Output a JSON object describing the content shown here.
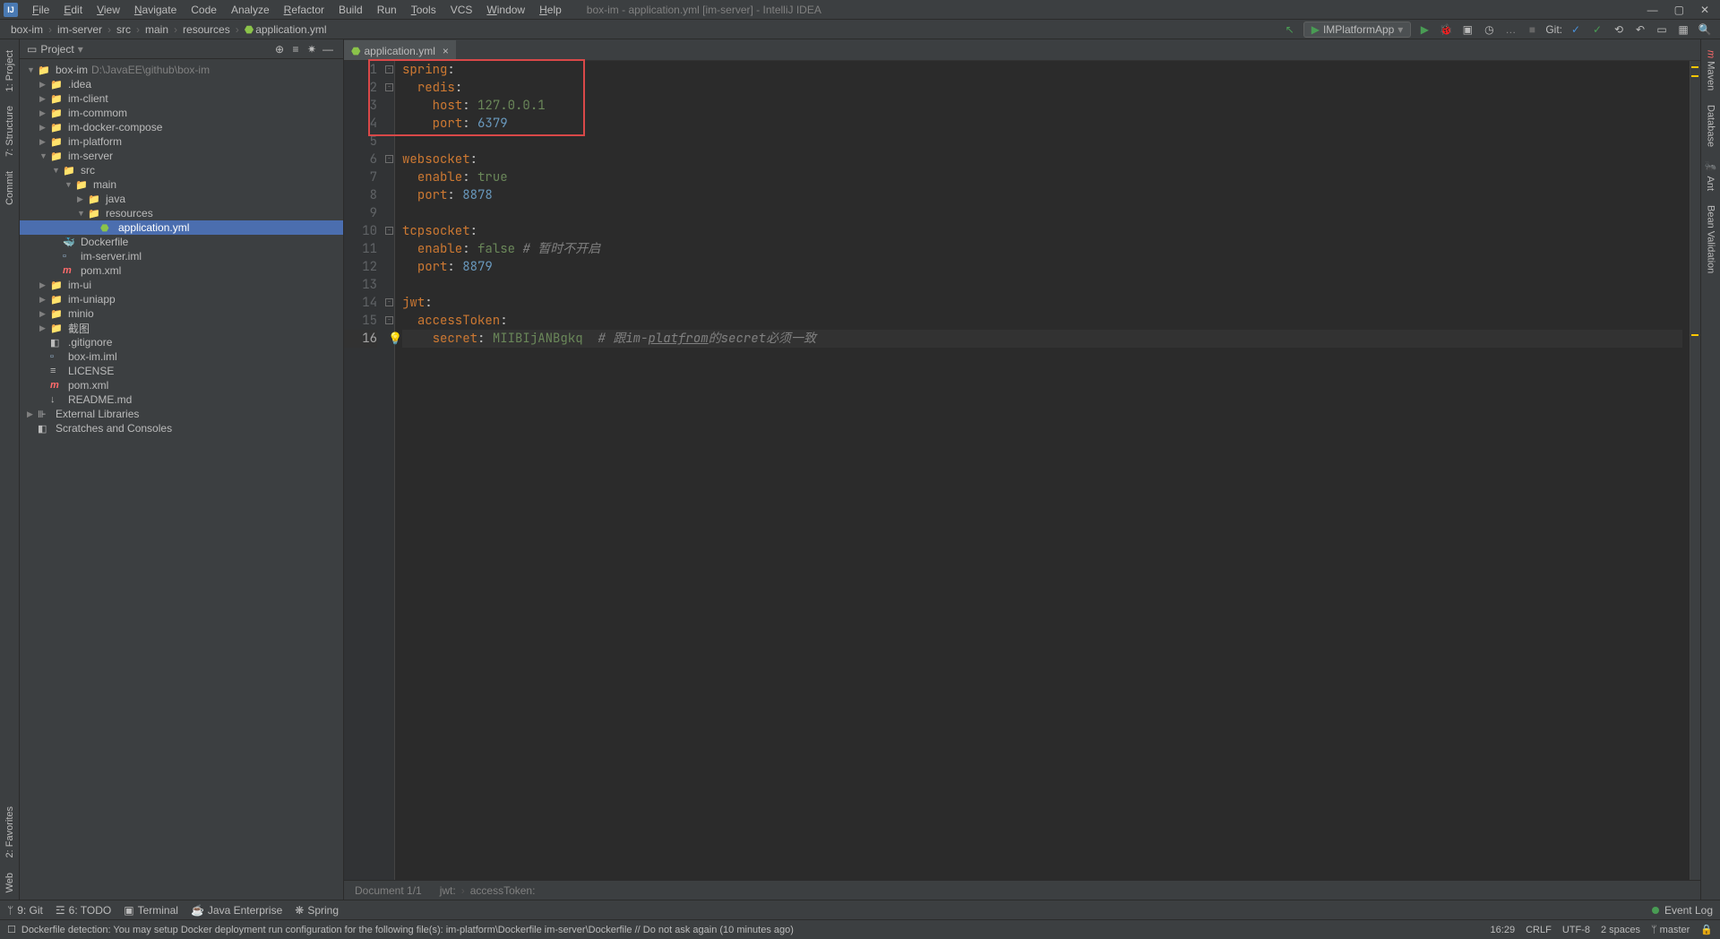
{
  "window": {
    "title": "box-im - application.yml [im-server] - IntelliJ IDEA"
  },
  "menu": {
    "file": "File",
    "edit": "Edit",
    "view": "View",
    "navigate": "Navigate",
    "code": "Code",
    "analyze": "Analyze",
    "refactor": "Refactor",
    "build": "Build",
    "run": "Run",
    "tools": "Tools",
    "vcs": "VCS",
    "window": "Window",
    "help": "Help"
  },
  "breadcrumb": [
    "box-im",
    "im-server",
    "src",
    "main",
    "resources",
    "application.yml"
  ],
  "runconfig": {
    "label": "IMPlatformApp",
    "git_label": "Git:"
  },
  "left_tabs": [
    "1: Project",
    "7: Structure",
    "Commit",
    "2: Favorites",
    "Web"
  ],
  "right_tabs": [
    "Maven",
    "Database",
    "Ant",
    "Bean Validation"
  ],
  "project_header": "Project",
  "tree": {
    "root": "box-im",
    "root_path": "D:\\JavaEE\\github\\box-im",
    "idea": ".idea",
    "im_client": "im-client",
    "im_commom": "im-commom",
    "im_docker": "im-docker-compose",
    "im_platform": "im-platform",
    "im_server": "im-server",
    "src": "src",
    "main": "main",
    "java": "java",
    "resources": "resources",
    "application_yml": "application.yml",
    "dockerfile": "Dockerfile",
    "im_server_iml": "im-server.iml",
    "pom": "pom.xml",
    "im_ui": "im-ui",
    "im_uniapp": "im-uniapp",
    "minio": "minio",
    "jietu": "截图",
    "gitignore": ".gitignore",
    "box_im_iml": "box-im.iml",
    "license": "LICENSE",
    "readme": "README.md",
    "ext_libs": "External Libraries",
    "scratches": "Scratches and Consoles"
  },
  "editor_tab": "application.yml",
  "code": [
    {
      "n": "1",
      "parts": [
        {
          "t": "spring",
          "c": "key"
        },
        {
          "t": ":",
          "c": ""
        }
      ]
    },
    {
      "n": "2",
      "parts": [
        {
          "t": "  ",
          "c": ""
        },
        {
          "t": "redis",
          "c": "key"
        },
        {
          "t": ":",
          "c": ""
        }
      ]
    },
    {
      "n": "3",
      "parts": [
        {
          "t": "    ",
          "c": ""
        },
        {
          "t": "host",
          "c": "key"
        },
        {
          "t": ": ",
          "c": ""
        },
        {
          "t": "127.0.0.1",
          "c": "val-str"
        }
      ]
    },
    {
      "n": "4",
      "parts": [
        {
          "t": "    ",
          "c": ""
        },
        {
          "t": "port",
          "c": "key"
        },
        {
          "t": ": ",
          "c": ""
        },
        {
          "t": "6379",
          "c": "val-num"
        }
      ]
    },
    {
      "n": "5",
      "parts": []
    },
    {
      "n": "6",
      "parts": [
        {
          "t": "websocket",
          "c": "key"
        },
        {
          "t": ":",
          "c": ""
        }
      ]
    },
    {
      "n": "7",
      "parts": [
        {
          "t": "  ",
          "c": ""
        },
        {
          "t": "enable",
          "c": "key"
        },
        {
          "t": ": ",
          "c": ""
        },
        {
          "t": "true",
          "c": "val-str"
        }
      ]
    },
    {
      "n": "8",
      "parts": [
        {
          "t": "  ",
          "c": ""
        },
        {
          "t": "port",
          "c": "key"
        },
        {
          "t": ": ",
          "c": ""
        },
        {
          "t": "8878",
          "c": "val-num"
        }
      ]
    },
    {
      "n": "9",
      "parts": []
    },
    {
      "n": "10",
      "parts": [
        {
          "t": "tcpsocket",
          "c": "key"
        },
        {
          "t": ":",
          "c": ""
        }
      ]
    },
    {
      "n": "11",
      "parts": [
        {
          "t": "  ",
          "c": ""
        },
        {
          "t": "enable",
          "c": "key"
        },
        {
          "t": ": ",
          "c": ""
        },
        {
          "t": "false ",
          "c": "val-str"
        },
        {
          "t": "# 暂时不开启",
          "c": "comment"
        }
      ]
    },
    {
      "n": "12",
      "parts": [
        {
          "t": "  ",
          "c": ""
        },
        {
          "t": "port",
          "c": "key"
        },
        {
          "t": ": ",
          "c": ""
        },
        {
          "t": "8879",
          "c": "val-num"
        }
      ]
    },
    {
      "n": "13",
      "parts": []
    },
    {
      "n": "14",
      "parts": [
        {
          "t": "jwt",
          "c": "key"
        },
        {
          "t": ":",
          "c": ""
        }
      ]
    },
    {
      "n": "15",
      "parts": [
        {
          "t": "  ",
          "c": ""
        },
        {
          "t": "accessToken",
          "c": "key"
        },
        {
          "t": ":",
          "c": ""
        }
      ]
    },
    {
      "n": "16",
      "parts": [
        {
          "t": "    ",
          "c": ""
        },
        {
          "t": "secret",
          "c": "key"
        },
        {
          "t": ": ",
          "c": ""
        },
        {
          "t": "MIIBIjANBgkq  ",
          "c": "val-str"
        },
        {
          "t": "# 跟im-",
          "c": "comment"
        },
        {
          "t": "platfrom",
          "c": "comment comment-u"
        },
        {
          "t": "的secret必须一致",
          "c": "comment"
        }
      ]
    }
  ],
  "breadcrumb_bar": {
    "doc": "Document 1/1",
    "p1": "jwt:",
    "p2": "accessToken:"
  },
  "bottom_tabs": {
    "git": "9: Git",
    "todo": "6: TODO",
    "terminal": "Terminal",
    "java_ee": "Java Enterprise",
    "spring": "Spring",
    "event_log": "Event Log"
  },
  "status": {
    "msg": "Dockerfile detection: You may setup Docker deployment run configuration for the following file(s): im-platform\\Dockerfile im-server\\Dockerfile // Do not ask again (10 minutes ago)",
    "pos": "16:29",
    "le": "CRLF",
    "enc": "UTF-8",
    "indent": "2 spaces",
    "branch": "master"
  }
}
